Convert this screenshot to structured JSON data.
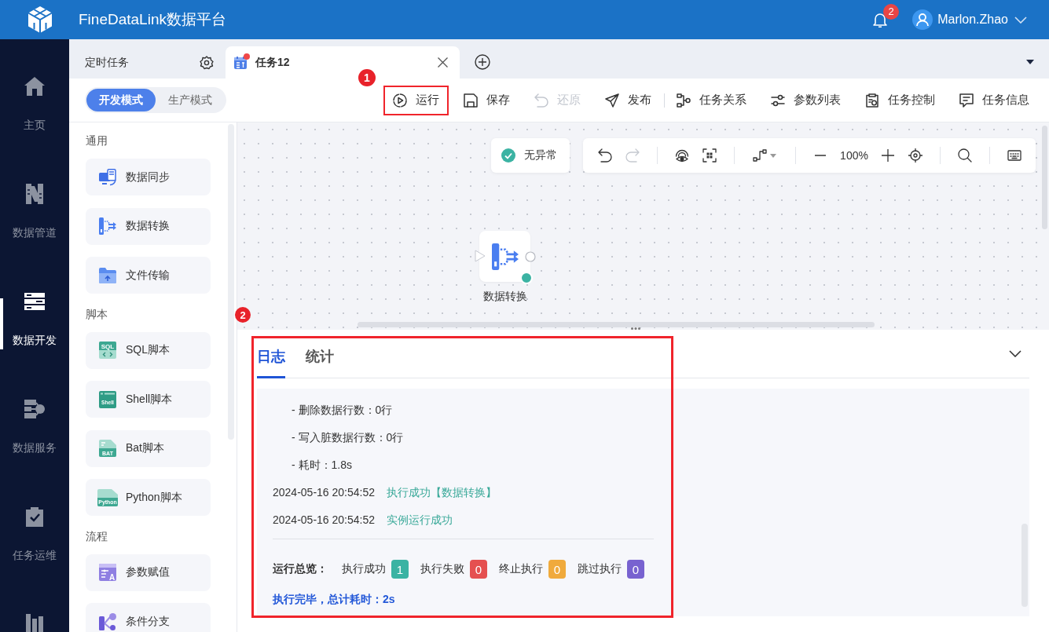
{
  "header": {
    "title": "FineDataLink数据平台",
    "notification_count": "2",
    "user_name": "Marlon.Zhao"
  },
  "nav_items": [
    {
      "kind": "home",
      "label": "主页",
      "selected": false
    },
    {
      "kind": "pipeline",
      "label": "数据管道",
      "selected": false
    },
    {
      "kind": "develop",
      "label": "数据开发",
      "selected": true
    },
    {
      "kind": "service",
      "label": "数据服务",
      "selected": false
    },
    {
      "kind": "ops",
      "label": "任务运维",
      "selected": false
    },
    {
      "kind": "report",
      "selected": false
    }
  ],
  "tabs": [
    {
      "kind": "schedule",
      "label": "定时任务",
      "selected": false,
      "modified": false
    },
    {
      "kind": "task",
      "label": "任务12",
      "selected": true,
      "modified": true
    }
  ],
  "modes": [
    {
      "label": "开发模式",
      "selected": true
    },
    {
      "label": "生产模式",
      "selected": false
    }
  ],
  "toolbar": {
    "groups": [
      {
        "buttons": [
          {
            "kind": "run",
            "label": "运行",
            "disabled": false,
            "highlighted": true,
            "callout": "1"
          },
          {
            "kind": "save",
            "label": "保存",
            "disabled": false,
            "highlighted": false
          },
          {
            "kind": "restore",
            "label": "还原",
            "disabled": true,
            "highlighted": false
          },
          {
            "kind": "publish",
            "label": "发布",
            "disabled": false,
            "highlighted": false
          }
        ]
      },
      {
        "buttons": [
          {
            "kind": "relations",
            "label": "任务关系",
            "disabled": false,
            "highlighted": false
          },
          {
            "kind": "params",
            "label": "参数列表",
            "disabled": false,
            "highlighted": false
          },
          {
            "kind": "control",
            "label": "任务控制",
            "disabled": false,
            "highlighted": false
          },
          {
            "kind": "info",
            "label": "任务信息",
            "disabled": false,
            "highlighted": false
          }
        ]
      }
    ]
  },
  "palette": {
    "sections": [
      {
        "title": "通用",
        "items": [
          {
            "kind": "sync",
            "label": "数据同步"
          },
          {
            "kind": "transform",
            "label": "数据转换"
          },
          {
            "kind": "file",
            "label": "文件传输"
          }
        ]
      },
      {
        "title": "脚本",
        "items": [
          {
            "kind": "sql",
            "label": "SQL脚本",
            "icon_text": "SQL"
          },
          {
            "kind": "shell",
            "label": "Shell脚本",
            "icon_text": "Shell"
          },
          {
            "kind": "bat",
            "label": "Bat脚本",
            "icon_text": "BAT"
          },
          {
            "kind": "python",
            "label": "Python脚本",
            "icon_text": "Python"
          }
        ]
      },
      {
        "title": "流程",
        "items": [
          {
            "kind": "assign",
            "label": "参数赋值",
            "icon_text": "A"
          },
          {
            "kind": "branch",
            "label": "条件分支"
          }
        ]
      }
    ]
  },
  "canvas": {
    "status": "无异常",
    "tool_groups": [
      {
        "tools": [
          {
            "kind": "undo",
            "disabled": false
          },
          {
            "kind": "redo",
            "disabled": true
          }
        ]
      },
      {
        "tools": [
          {
            "kind": "preview",
            "disabled": false
          },
          {
            "kind": "fit",
            "disabled": false
          }
        ]
      },
      {
        "tools": [
          {
            "kind": "connector",
            "disabled": false
          }
        ]
      },
      {
        "tools": [
          {
            "kind": "zoom_out",
            "disabled": false
          },
          {
            "kind": "zoom_level",
            "label": "100%",
            "disabled": false
          },
          {
            "kind": "zoom_in",
            "disabled": false
          },
          {
            "kind": "locate",
            "disabled": false
          }
        ]
      },
      {
        "tools": [
          {
            "kind": "search",
            "disabled": false
          }
        ]
      },
      {
        "tools": [
          {
            "kind": "keyboard",
            "disabled": false
          }
        ]
      }
    ],
    "nodes": [
      {
        "kind": "transform",
        "label": "数据转换",
        "success": true
      }
    ]
  },
  "log_panel": {
    "highlighted": true,
    "callout": "2",
    "tabs": [
      {
        "label": "日志",
        "selected": true
      },
      {
        "label": "统计",
        "selected": false
      }
    ],
    "lines": [
      {
        "kind": "detail",
        "text": "- 删除数据行数：0行"
      },
      {
        "kind": "detail",
        "text": "- 写入脏数据行数：0行"
      },
      {
        "kind": "detail",
        "text": "- 耗时：1.8s"
      },
      {
        "kind": "event",
        "time": "2024-05-16 20:54:52",
        "message": "执行成功【数据转换】",
        "success": true
      },
      {
        "kind": "event",
        "time": "2024-05-16 20:54:52",
        "message": "实例运行成功",
        "success": true
      }
    ],
    "summary": {
      "label": "运行总览：",
      "counts": [
        {
          "label": "执行成功",
          "value": "1",
          "color": "#3bb3a3"
        },
        {
          "label": "执行失败",
          "value": "0",
          "color": "#e55050"
        },
        {
          "label": "终止执行",
          "value": "0",
          "color": "#f0aa3c"
        },
        {
          "label": "跳过执行",
          "value": "0",
          "color": "#7862d0"
        }
      ]
    },
    "footer": "执行完毕，总计耗时：2s"
  }
}
